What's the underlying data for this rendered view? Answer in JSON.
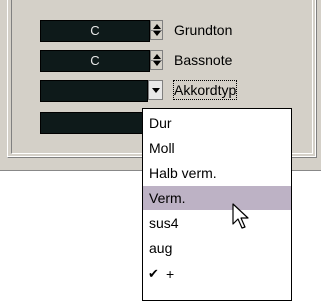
{
  "fields": [
    {
      "value": "C",
      "label": "Grundton",
      "control": "spinner"
    },
    {
      "value": "C",
      "label": "Bassnote",
      "control": "spinner"
    },
    {
      "value": "",
      "label": "Akkordtyp",
      "control": "dropdown"
    },
    {
      "value": "",
      "label": "",
      "control": "none"
    }
  ],
  "menu": {
    "items": [
      {
        "label": "Dur",
        "checked": false,
        "hover": false
      },
      {
        "label": "Moll",
        "checked": false,
        "hover": false
      },
      {
        "label": "Halb verm.",
        "checked": false,
        "hover": false
      },
      {
        "label": "Verm.",
        "checked": false,
        "hover": true
      },
      {
        "label": "sus4",
        "checked": false,
        "hover": false
      },
      {
        "label": "aug",
        "checked": false,
        "hover": false
      },
      {
        "label": "+",
        "checked": true,
        "hover": false
      }
    ],
    "check_glyph": "✔"
  },
  "colors": {
    "panel": "#d4d0c8",
    "field": "#0e1a1a",
    "menu_hover": "#bdb2c5"
  },
  "icons": {
    "spin": "spin-arrows-icon",
    "dropdown": "chevron-down-icon",
    "cursor": "mouse-pointer-icon"
  }
}
